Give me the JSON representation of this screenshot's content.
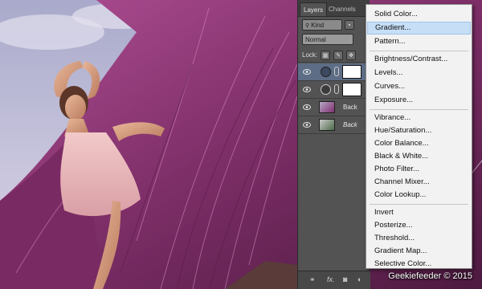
{
  "panel": {
    "tabs": [
      "Layers",
      "Channels"
    ],
    "filter_label": "Kind",
    "blend_mode": "Normal",
    "lock_label": "Lock:",
    "layers": [
      {
        "name": "",
        "selected": true,
        "thumb": "adjustment"
      },
      {
        "name": "",
        "selected": false,
        "thumb": "adjustment"
      },
      {
        "name": "Back",
        "selected": false,
        "thumb": "photo"
      },
      {
        "name": "Back",
        "selected": false,
        "thumb": "photo",
        "italic": true
      }
    ],
    "bottom_icons": [
      "link-icon",
      "fx-icon",
      "mask-icon",
      "adjustment-icon"
    ],
    "bottom_fx_label": "fx."
  },
  "menu": {
    "items": [
      {
        "label": "Solid Color...",
        "hover": false
      },
      {
        "label": "Gradient...",
        "hover": true
      },
      {
        "label": "Pattern...",
        "hover": false
      },
      {
        "label": "Brightness/Contrast...",
        "hover": false
      },
      {
        "label": "Levels...",
        "hover": false
      },
      {
        "label": "Curves...",
        "hover": false
      },
      {
        "label": "Exposure...",
        "hover": false
      },
      {
        "label": "Vibrance...",
        "hover": false
      },
      {
        "label": "Hue/Saturation...",
        "hover": false
      },
      {
        "label": "Color Balance...",
        "hover": false
      },
      {
        "label": "Black & White...",
        "hover": false
      },
      {
        "label": "Photo Filter...",
        "hover": false
      },
      {
        "label": "Channel Mixer...",
        "hover": false
      },
      {
        "label": "Color Lookup...",
        "hover": false
      },
      {
        "label": "Invert",
        "hover": false
      },
      {
        "label": "Posterize...",
        "hover": false
      },
      {
        "label": "Threshold...",
        "hover": false
      },
      {
        "label": "Gradient Map...",
        "hover": false
      },
      {
        "label": "Selective Color...",
        "hover": false
      }
    ],
    "hover_color": "#c6dff7"
  },
  "credit": "Geekiefeeder © 2015",
  "colors": {
    "panel_bg": "#535353",
    "menu_bg": "#f2f2f2",
    "grass": "#8e3a74",
    "sky": "#b7b8d3"
  }
}
